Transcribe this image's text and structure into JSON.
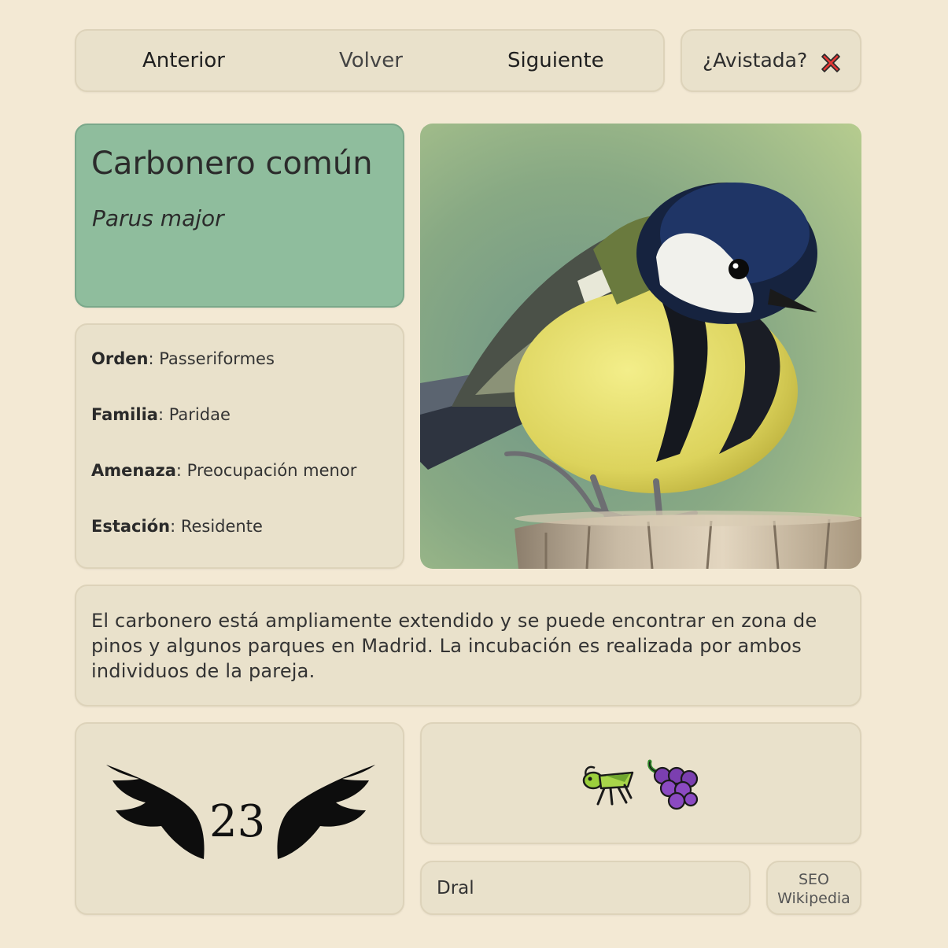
{
  "nav": {
    "prev_label": "Anterior",
    "back_label": "Volver",
    "next_label": "Siguiente"
  },
  "sighted": {
    "label": "¿Avistada?",
    "icon": "cross-mark-icon",
    "state": false
  },
  "bird": {
    "common_name": "Carbonero común",
    "scientific_name": "Parus major"
  },
  "facts": [
    {
      "key": "Orden",
      "value": "Passeriformes"
    },
    {
      "key": "Familia",
      "value": "Paridae"
    },
    {
      "key": "Amenaza",
      "value": "Preocupación menor"
    },
    {
      "key": "Estación",
      "value": "Residente"
    }
  ],
  "description": "El carbonero está ampliamente extendido y se puede encontrar en zona de pinos y algunos parques en Madrid. La incubación es realizada por ambos individuos de la pareja.",
  "wingspan": {
    "value": "23",
    "icon": "wings-icon"
  },
  "diet": {
    "icons": [
      "grasshopper-icon",
      "grapes-icon"
    ]
  },
  "links": {
    "dral_label": "Dral",
    "seo_label": "SEO",
    "wikipedia_label": "Wikipedia"
  },
  "colors": {
    "background": "#f3e9d4",
    "card": "#e9e1cb",
    "title_card": "#8fbd9d",
    "cross_red": "#e53935"
  }
}
